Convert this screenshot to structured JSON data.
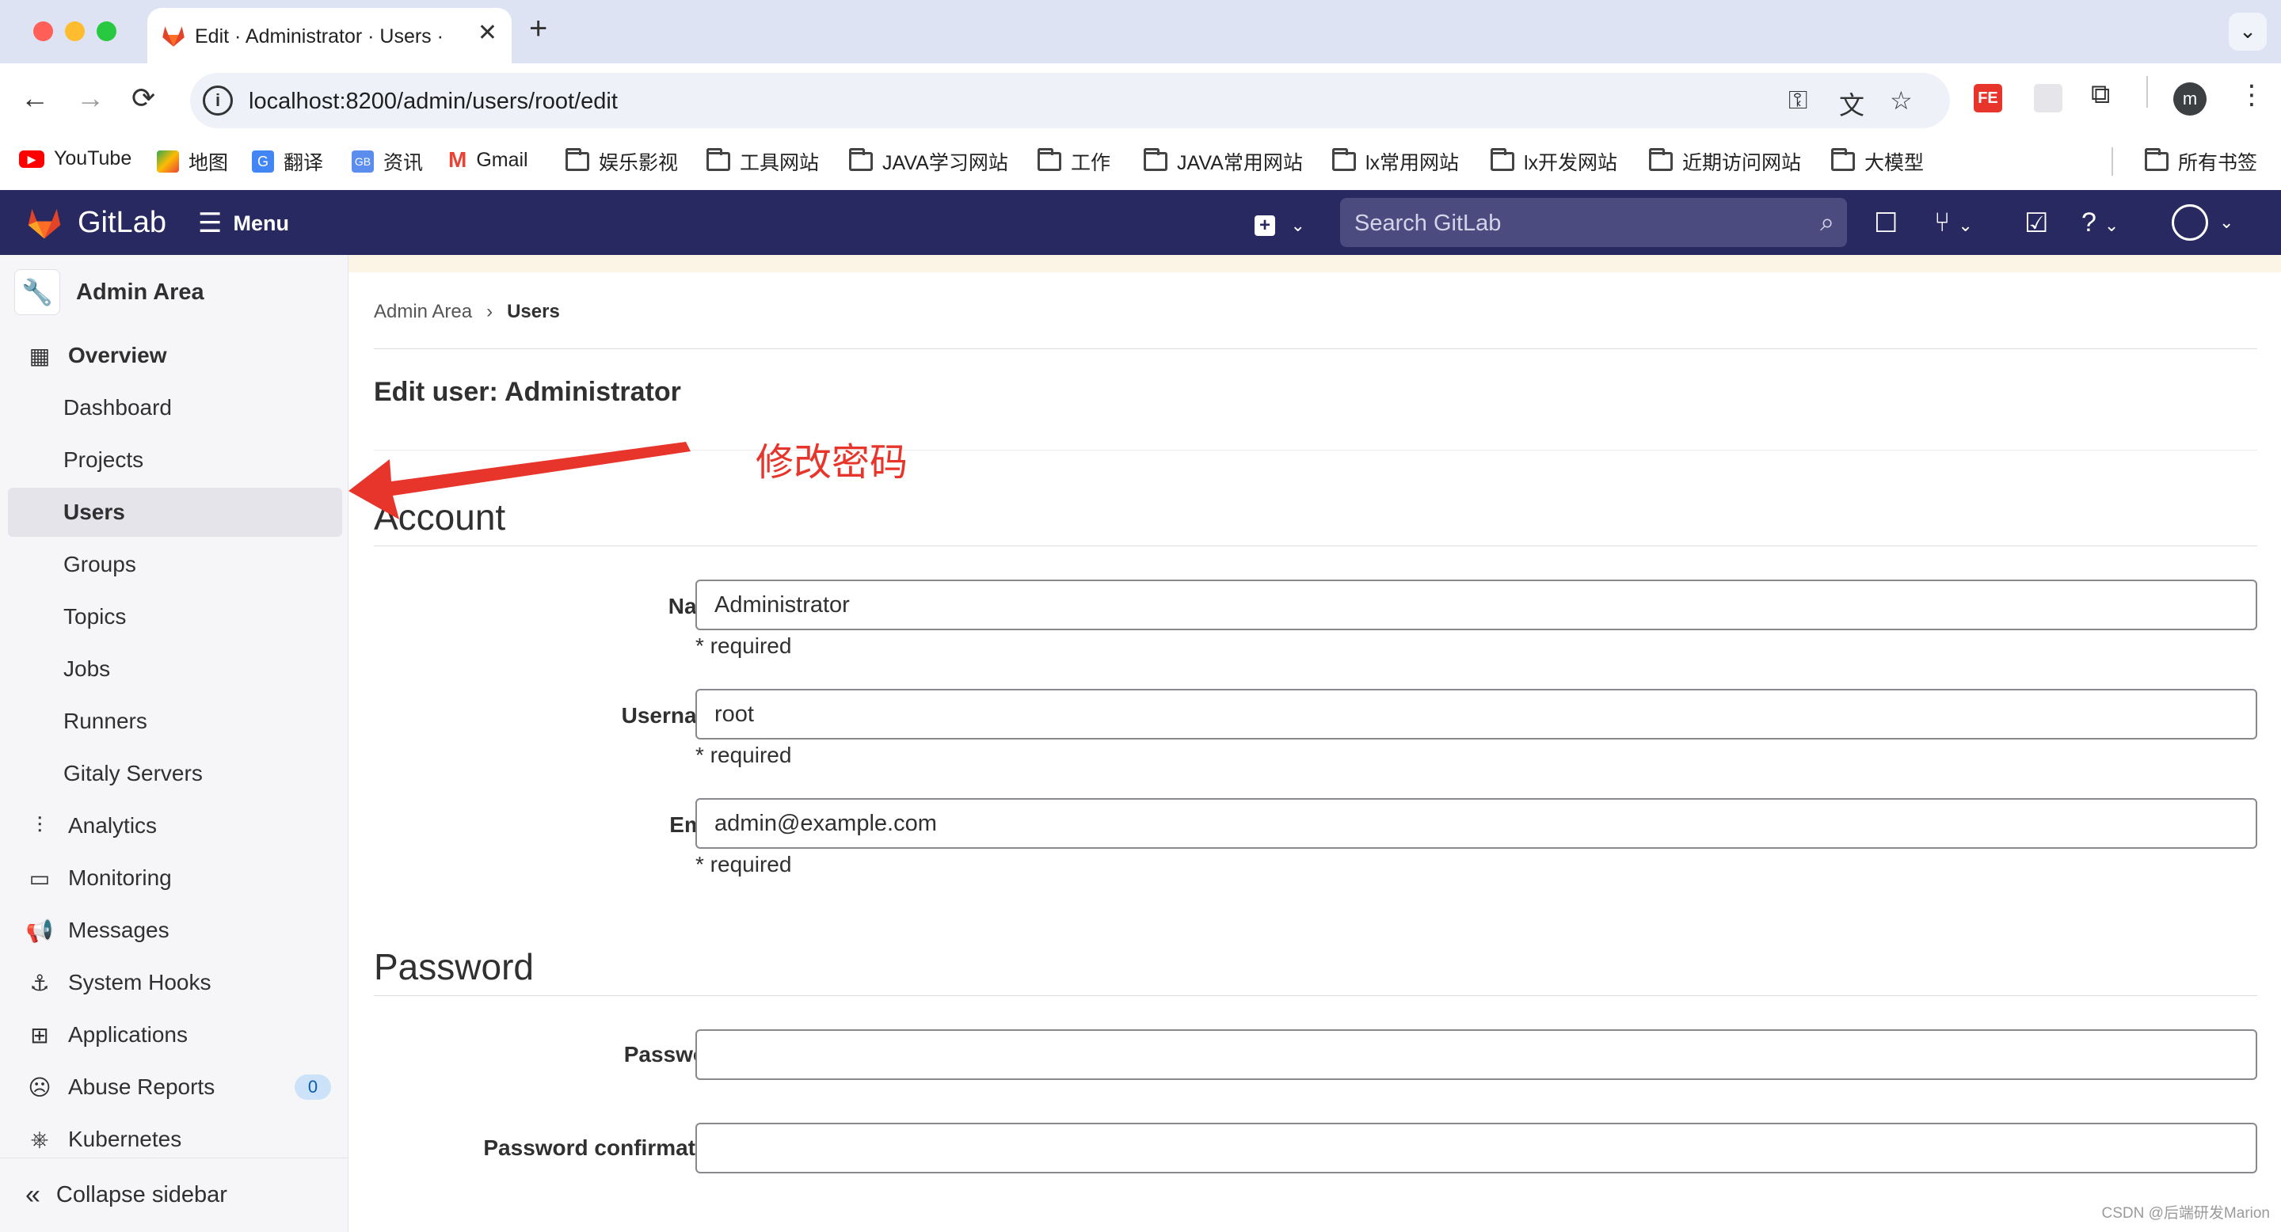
{
  "browser": {
    "tab_title": "Edit · Administrator · Users ·",
    "tab_close": "✕",
    "new_tab": "+",
    "url": "localhost:8200/admin/users/root/edit",
    "profile_initial": "m",
    "bookmarks": [
      {
        "label": "YouTube",
        "icon": "youtube-icon"
      },
      {
        "label": "地图",
        "icon": "maps-icon"
      },
      {
        "label": "翻译",
        "icon": "translate-icon"
      },
      {
        "label": "资讯",
        "icon": "news-icon"
      },
      {
        "label": "Gmail",
        "icon": "gmail-icon"
      },
      {
        "label": "娱乐影视",
        "icon": "folder-icon"
      },
      {
        "label": "工具网站",
        "icon": "folder-icon"
      },
      {
        "label": "JAVA学习网站",
        "icon": "folder-icon"
      },
      {
        "label": "工作",
        "icon": "folder-icon"
      },
      {
        "label": "JAVA常用网站",
        "icon": "folder-icon"
      },
      {
        "label": "lx常用网站",
        "icon": "folder-icon"
      },
      {
        "label": "lx开发网站",
        "icon": "folder-icon"
      },
      {
        "label": "近期访问网站",
        "icon": "folder-icon"
      },
      {
        "label": "大模型",
        "icon": "folder-icon"
      }
    ],
    "all_bookmarks": "所有书签"
  },
  "header": {
    "logo_text": "GitLab",
    "menu_label": "Menu",
    "search_placeholder": "Search GitLab"
  },
  "sidebar": {
    "context_title": "Admin Area",
    "items": [
      {
        "label": "Overview",
        "icon": "overview-icon",
        "type": "section"
      },
      {
        "label": "Dashboard",
        "type": "sub"
      },
      {
        "label": "Projects",
        "type": "sub"
      },
      {
        "label": "Users",
        "type": "sub",
        "active": true
      },
      {
        "label": "Groups",
        "type": "sub"
      },
      {
        "label": "Topics",
        "type": "sub"
      },
      {
        "label": "Jobs",
        "type": "sub"
      },
      {
        "label": "Runners",
        "type": "sub"
      },
      {
        "label": "Gitaly Servers",
        "type": "sub"
      },
      {
        "label": "Analytics",
        "icon": "chart-icon",
        "type": "top"
      },
      {
        "label": "Monitoring",
        "icon": "monitor-icon",
        "type": "top"
      },
      {
        "label": "Messages",
        "icon": "megaphone-icon",
        "type": "top"
      },
      {
        "label": "System Hooks",
        "icon": "anchor-icon",
        "type": "top"
      },
      {
        "label": "Applications",
        "icon": "applications-icon",
        "type": "top"
      },
      {
        "label": "Abuse Reports",
        "icon": "abuse-icon",
        "type": "top",
        "badge": "0"
      },
      {
        "label": "Kubernetes",
        "icon": "kubernetes-icon",
        "type": "top"
      }
    ],
    "collapse_label": "Collapse sidebar"
  },
  "main": {
    "breadcrumb": [
      "Admin Area",
      "Users"
    ],
    "breadcrumb_sep": "›",
    "page_title": "Edit user: Administrator",
    "account_title": "Account",
    "password_title": "Password",
    "fields": {
      "name": {
        "label": "Name",
        "value": "Administrator",
        "help": "* required"
      },
      "username": {
        "label": "Username",
        "value": "root",
        "help": "* required"
      },
      "email": {
        "label": "Email",
        "value": "admin@example.com",
        "help": "* required"
      },
      "password": {
        "label": "Password",
        "value": ""
      },
      "password_confirmation": {
        "label": "Password confirmation",
        "value": ""
      }
    }
  },
  "annotation": "修改密码",
  "watermark": "CSDN @后端研发Marion",
  "colors": {
    "gitlab_header": "#292961",
    "annotation_red": "#e8352b",
    "sidebar_bg": "#f6f6f9"
  }
}
